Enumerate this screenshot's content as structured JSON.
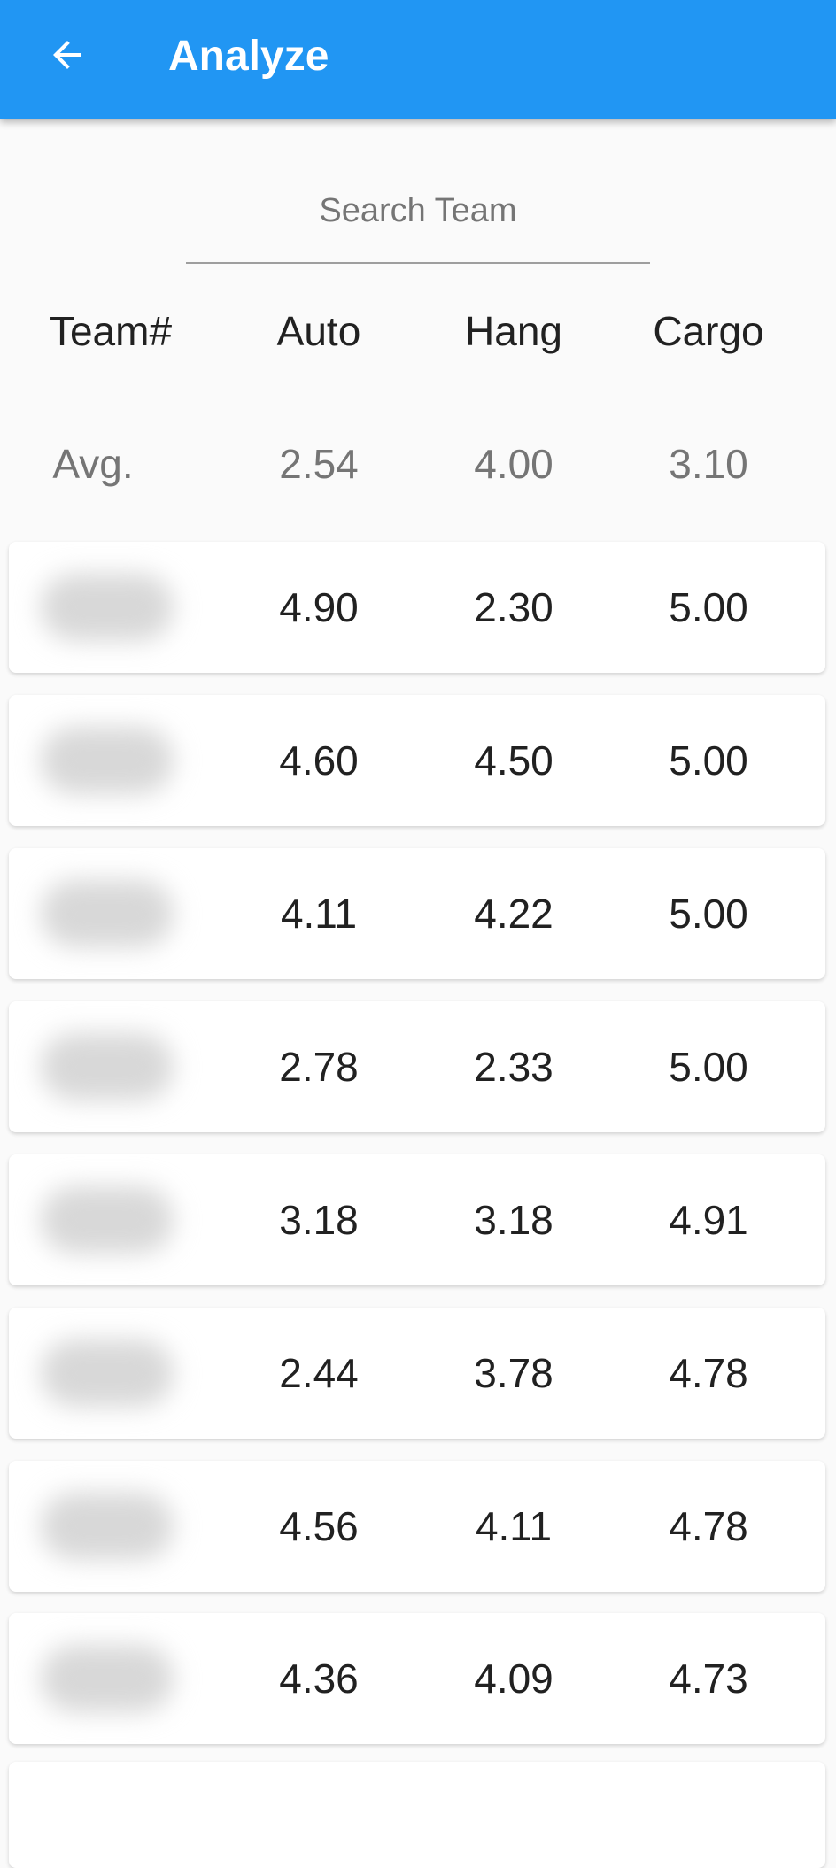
{
  "appbar": {
    "title": "Analyze",
    "back_icon": "arrow-left-icon",
    "color": "#2196f3"
  },
  "search": {
    "placeholder": "Search Team",
    "value": ""
  },
  "table": {
    "headers": [
      "Team#",
      "Auto",
      "Hang",
      "Cargo"
    ],
    "average": {
      "label": "Avg.",
      "auto": "2.54",
      "hang": "4.00",
      "cargo": "3.10"
    },
    "rows": [
      {
        "auto": "4.90",
        "hang": "2.30",
        "cargo": "5.00"
      },
      {
        "auto": "4.60",
        "hang": "4.50",
        "cargo": "5.00"
      },
      {
        "auto": "4.11",
        "hang": "4.22",
        "cargo": "5.00"
      },
      {
        "auto": "2.78",
        "hang": "2.33",
        "cargo": "5.00"
      },
      {
        "auto": "3.18",
        "hang": "3.18",
        "cargo": "4.91"
      },
      {
        "auto": "2.44",
        "hang": "3.78",
        "cargo": "4.78"
      },
      {
        "auto": "4.56",
        "hang": "4.11",
        "cargo": "4.78"
      },
      {
        "auto": "4.36",
        "hang": "4.09",
        "cargo": "4.73"
      }
    ]
  }
}
